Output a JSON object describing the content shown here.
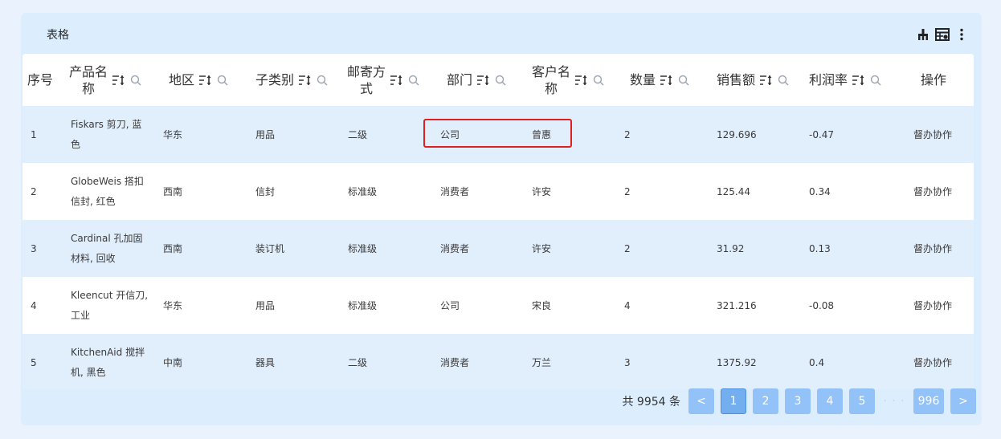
{
  "title": "表格",
  "toolbar": {
    "icons": [
      "broom-icon",
      "table-settings-icon",
      "more-vertical-icon"
    ]
  },
  "columns": [
    {
      "label": "序号",
      "sortable": false,
      "searchable": false
    },
    {
      "label": "产品名\n称",
      "sortable": true,
      "searchable": true
    },
    {
      "label": "地区",
      "sortable": true,
      "searchable": true
    },
    {
      "label": "子类别",
      "sortable": true,
      "searchable": true
    },
    {
      "label": "邮寄方\n式",
      "sortable": true,
      "searchable": true
    },
    {
      "label": "部门",
      "sortable": true,
      "searchable": true
    },
    {
      "label": "客户名\n称",
      "sortable": true,
      "searchable": true
    },
    {
      "label": "数量",
      "sortable": true,
      "searchable": true
    },
    {
      "label": "销售额",
      "sortable": true,
      "searchable": true
    },
    {
      "label": "利润率",
      "sortable": true,
      "searchable": true
    },
    {
      "label": "操作",
      "sortable": false,
      "searchable": false
    }
  ],
  "rows": [
    {
      "index": "1",
      "product": [
        "Fiskars 剪刀, 蓝",
        "色"
      ],
      "region": "华东",
      "subcategory": "用品",
      "shipping": "二级",
      "department": "公司",
      "customer": "曾惠",
      "quantity": "2",
      "sales": "129.696",
      "profit_rate": "-0.47",
      "action": "督办协作"
    },
    {
      "index": "2",
      "product": [
        "GlobeWeis 搭扣",
        "信封, 红色"
      ],
      "region": "西南",
      "subcategory": "信封",
      "shipping": "标准级",
      "department": "消费者",
      "customer": "许安",
      "quantity": "2",
      "sales": "125.44",
      "profit_rate": "0.34",
      "action": "督办协作"
    },
    {
      "index": "3",
      "product": [
        "Cardinal 孔加固",
        "材料, 回收"
      ],
      "region": "西南",
      "subcategory": "装订机",
      "shipping": "标准级",
      "department": "消费者",
      "customer": "许安",
      "quantity": "2",
      "sales": "31.92",
      "profit_rate": "0.13",
      "action": "督办协作"
    },
    {
      "index": "4",
      "product": [
        "Kleencut 开信刀,",
        "工业"
      ],
      "region": "华东",
      "subcategory": "用品",
      "shipping": "标准级",
      "department": "公司",
      "customer": "宋良",
      "quantity": "4",
      "sales": "321.216",
      "profit_rate": "-0.08",
      "action": "督办协作"
    },
    {
      "index": "5",
      "product": [
        "KitchenAid 搅拌",
        "机, 黑色"
      ],
      "region": "中南",
      "subcategory": "器具",
      "shipping": "二级",
      "department": "消费者",
      "customer": "万兰",
      "quantity": "3",
      "sales": "1375.92",
      "profit_rate": "0.4",
      "action": "督办协作"
    }
  ],
  "pagination": {
    "total_text": "共 9954 条",
    "prev": "<",
    "next": ">",
    "pages": [
      "1",
      "2",
      "3",
      "4",
      "5"
    ],
    "ellipsis": "· · ·",
    "last": "996",
    "current": "1"
  },
  "colors": {
    "accent": "#92c2f8",
    "row_stripe": "#e1eefc",
    "highlight": "#e02020"
  }
}
